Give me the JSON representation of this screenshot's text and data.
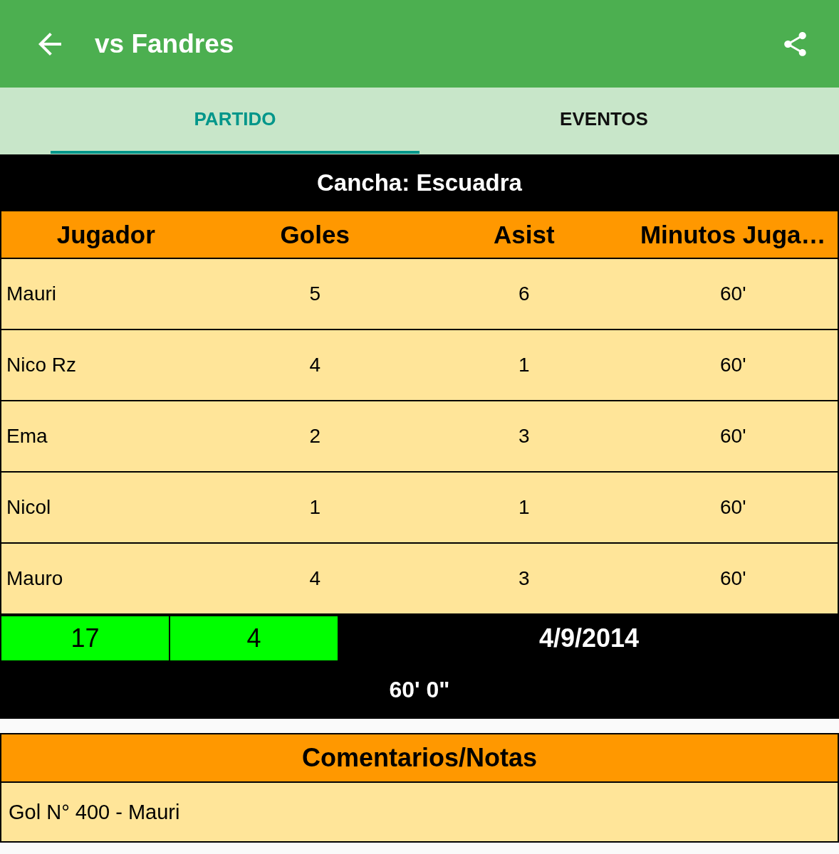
{
  "app_bar": {
    "title": "vs Fandres"
  },
  "tabs": [
    {
      "label": "PARTIDO",
      "selected": true
    },
    {
      "label": "EVENTOS",
      "selected": false
    }
  ],
  "field_banner": "Cancha: Escuadra",
  "table": {
    "columns": [
      "Jugador",
      "Goles",
      "Asist",
      "Minutos Juga…"
    ],
    "rows": [
      [
        "Mauri",
        "5",
        "6",
        "60'"
      ],
      [
        "Nico Rz",
        "4",
        "1",
        "60'"
      ],
      [
        "Ema",
        "2",
        "3",
        "60'"
      ],
      [
        "Nicol",
        "1",
        "1",
        "60'"
      ],
      [
        "Mauro",
        "4",
        "3",
        "60'"
      ]
    ]
  },
  "result": {
    "score": [
      "17",
      "4"
    ],
    "date": "4/9/2014",
    "duration": "60' 0\""
  },
  "notes": {
    "title": "Comentarios/Notas",
    "text": "Gol N° 400 - Mauri"
  }
}
